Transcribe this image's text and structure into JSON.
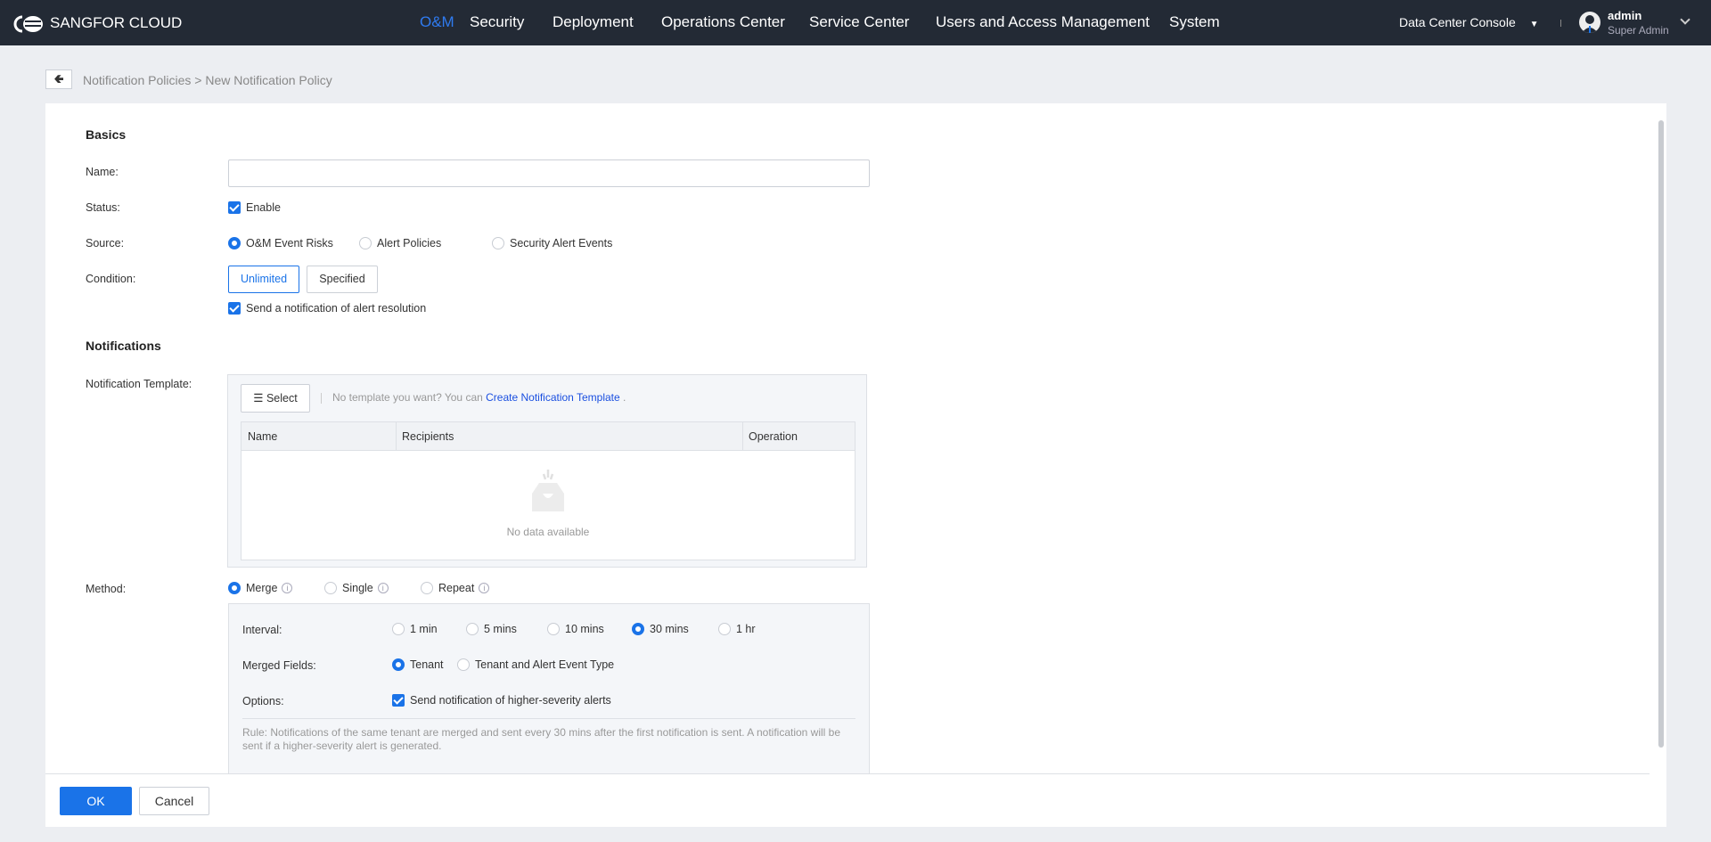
{
  "header": {
    "brand": "SANGFOR CLOUD",
    "nav": [
      "O&M",
      "Security",
      "Deployment",
      "Operations Center",
      "Service Center",
      "Users and Access Management",
      "System"
    ],
    "active_nav": "O&M",
    "console": "Data Center Console",
    "user": {
      "name": "admin",
      "role": "Super Admin"
    }
  },
  "breadcrumb": {
    "parent": "Notification Policies",
    "separator": ">",
    "current": "New Notification Policy"
  },
  "basics": {
    "title": "Basics",
    "name_label": "Name:",
    "name_value": "",
    "status_label": "Status:",
    "status_enable": "Enable",
    "source_label": "Source:",
    "sources": [
      "O&M Event Risks",
      "Alert Policies",
      "Security Alert Events"
    ],
    "source_selected": "O&M Event Risks",
    "condition_label": "Condition:",
    "condition_buttons": [
      "Unlimited",
      "Specified"
    ],
    "condition_selected": "Unlimited",
    "resolution_checkbox": "Send a notification of alert resolution"
  },
  "notifications": {
    "title": "Notifications",
    "template_label": "Notification Template:",
    "select_button": "Select",
    "hint": "No template you want? You can",
    "create_link": "Create Notification Template",
    "hint_end": ".",
    "columns": [
      "Name",
      "Recipients",
      "Operation"
    ],
    "empty": "No data available",
    "method_label": "Method:",
    "methods": [
      "Merge",
      "Single",
      "Repeat"
    ],
    "method_selected": "Merge",
    "interval_label": "Interval:",
    "intervals": [
      "1 min",
      "5 mins",
      "10 mins",
      "30 mins",
      "1 hr"
    ],
    "interval_selected": "30 mins",
    "merged_label": "Merged Fields:",
    "merged_fields": [
      "Tenant",
      "Tenant and Alert Event Type"
    ],
    "merged_selected": "Tenant",
    "options_label": "Options:",
    "options_checkbox": "Send notification of higher-severity alerts",
    "rule": "Rule: Notifications of the same tenant are merged and sent every 30 mins after the first notification is sent. A notification will be sent if a higher-severity alert is generated."
  },
  "footer": {
    "ok": "OK",
    "cancel": "Cancel"
  },
  "colors": {
    "accent": "#1a73e8",
    "topbar": "#232a35"
  }
}
